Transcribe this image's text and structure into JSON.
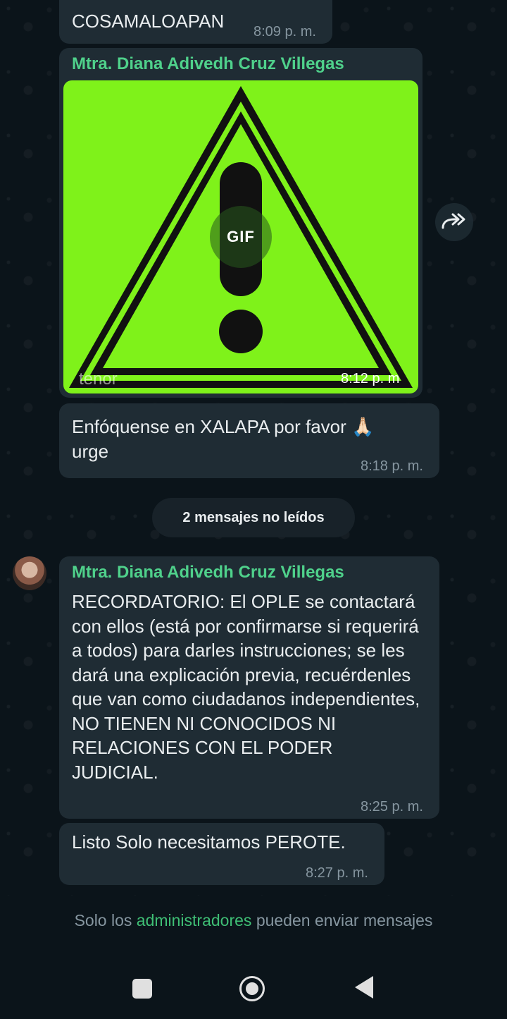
{
  "messages": [
    {
      "text": "COSAMALOAPAN",
      "time": "8:09 p. m."
    },
    {
      "sender": "Mtra. Diana Adivedh Cruz Villegas",
      "gif_label": "GIF",
      "gif_watermark": "tenor",
      "time": "8:12 p. m"
    },
    {
      "text": "Enfóquense en XALAPA por favor 🙏🏻 urge",
      "time": "8:18 p. m."
    },
    {
      "sender": "Mtra. Diana Adivedh Cruz Villegas",
      "text": "RECORDATORIO: El OPLE se contactará con ellos (está por confirmarse si requerirá a todos) para darles instrucciones; se les dará una explicación previa, recuérdenles que van como ciudadanos independientes, NO TIENEN NI CONOCIDOS NI RELACIONES CON EL PODER JUDICIAL.",
      "time": "8:25 p. m."
    },
    {
      "text": "Listo Solo necesitamos PEROTE.",
      "time": "8:27 p. m."
    }
  ],
  "unread_label": "2 mensajes no leídos",
  "footer": {
    "prefix": "Solo los",
    "link": "administradores",
    "suffix": "pueden enviar mensajes"
  },
  "icons": {
    "forward": "forward-icon",
    "recents": "recents-icon",
    "home": "home-icon",
    "back": "back-icon"
  },
  "colors": {
    "background": "#0b141a",
    "bubble": "#1f2c34",
    "gif_green": "#7ff21a",
    "sender": "#4fd18b",
    "admin_link": "#3fbf75"
  }
}
